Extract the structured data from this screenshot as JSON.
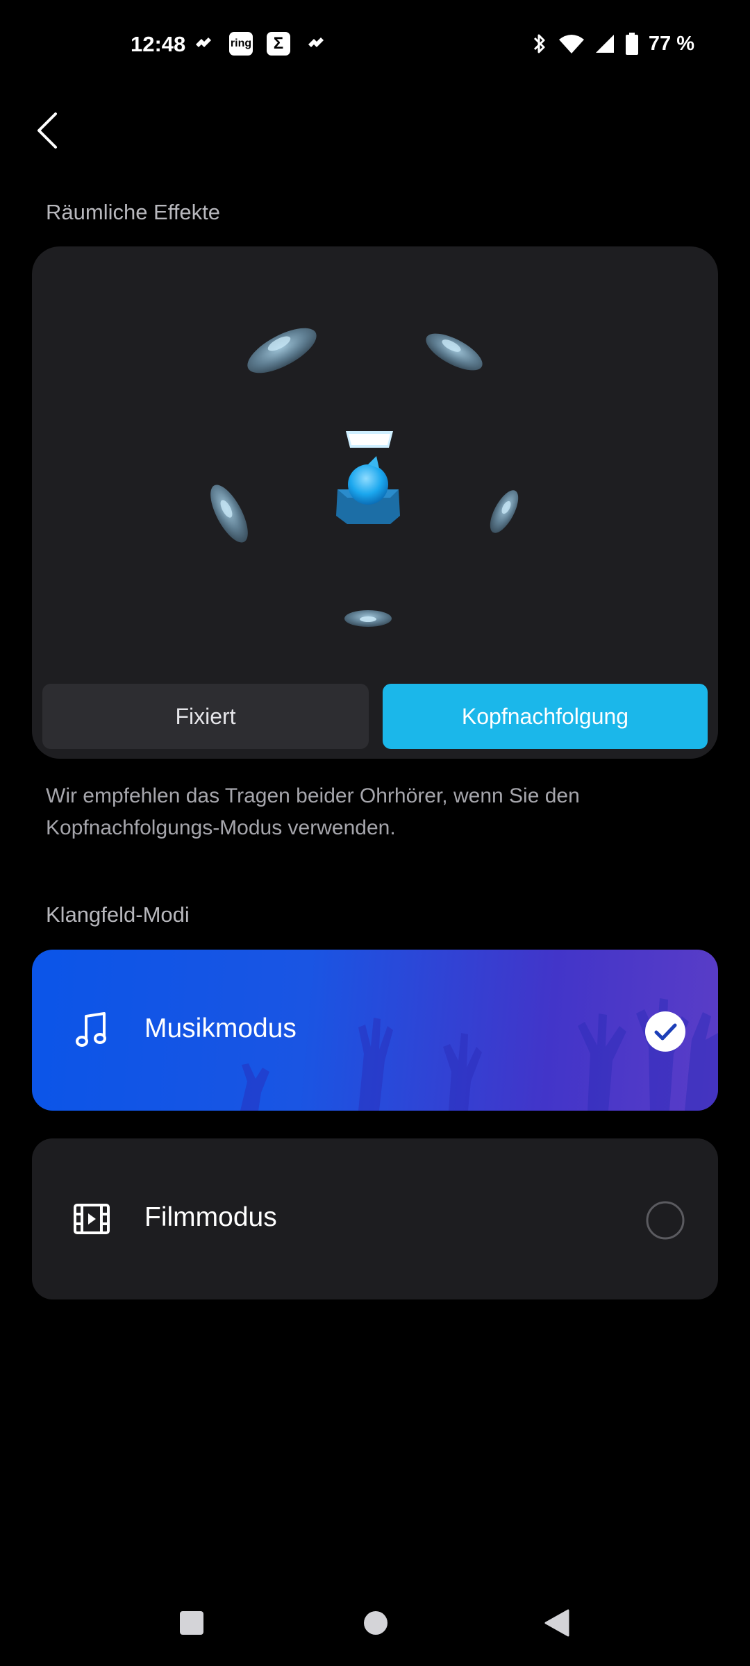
{
  "status_bar": {
    "time": "12:48",
    "ring_label": "ring",
    "sigma_label": "Σ",
    "battery": "77 %"
  },
  "spatial": {
    "section_title": "Räumliche Effekte",
    "fixed_label": "Fixiert",
    "head_tracking_label": "Kopfnachfolgung",
    "selected": "Kopfnachfolgung",
    "hint": "Wir empfehlen das Tragen beider Ohrhörer, wenn Sie den Kopfnachfolgungs-Modus verwenden."
  },
  "sound_field": {
    "section_title": "Klangfeld-Modi",
    "modes": [
      {
        "label": "Musikmodus",
        "icon": "music-note-icon",
        "selected": true
      },
      {
        "label": "Filmmodus",
        "icon": "film-icon",
        "selected": false
      }
    ]
  },
  "colors": {
    "accent": "#1bb7ea",
    "music_card_start": "#0b55e8",
    "music_card_end": "#5a3dc7",
    "card_bg": "#1e1e21"
  }
}
